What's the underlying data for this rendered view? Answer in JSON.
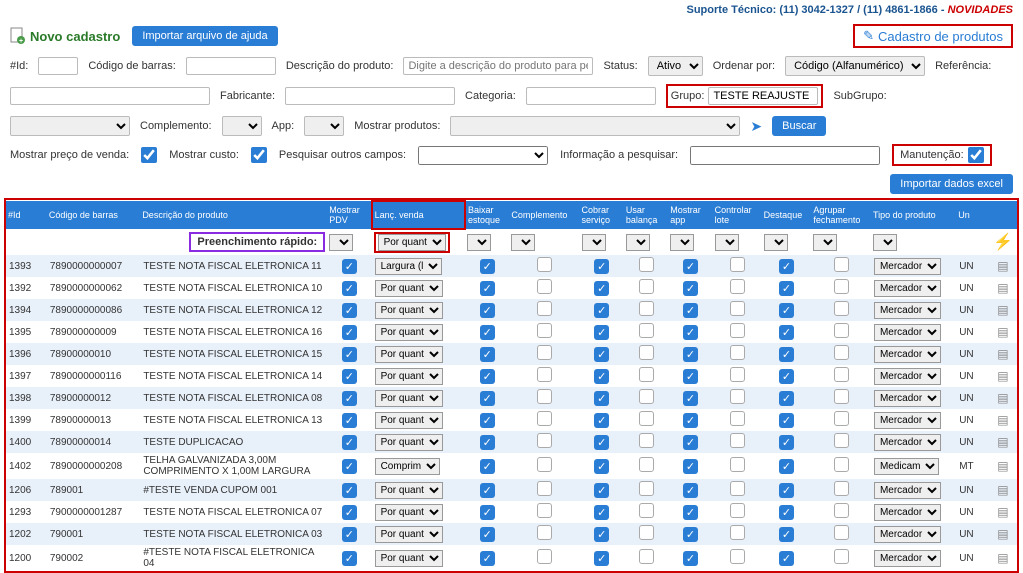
{
  "top": {
    "support_text": "Suporte Técnico: (11) 3042-1327 / (11) 4861-1866 -",
    "novidades": "NOVIDADES"
  },
  "header": {
    "novo_cadastro": "Novo cadastro",
    "importar_ajuda": "Importar arquivo de ajuda",
    "cadastro_produtos": "Cadastro de produtos"
  },
  "filters": {
    "id_label": "#Id:",
    "codigo_barras_label": "Código de barras:",
    "descricao_label": "Descrição do produto:",
    "descricao_placeholder": "Digite a descrição do produto para pesquisa",
    "status_label": "Status:",
    "status_value": "Ativo",
    "ordenar_label": "Ordenar por:",
    "ordenar_value": "Código (Alfanumérico)",
    "referencia_label": "Referência:",
    "fabricante_label": "Fabricante:",
    "categoria_label": "Categoria:",
    "grupo_label": "Grupo:",
    "grupo_value": "TESTE REAJUSTE",
    "subgrupo_label": "SubGrupo:",
    "complemento_label": "Complemento:",
    "app_label": "App:",
    "mostrar_produtos_label": "Mostrar produtos:",
    "buscar": "Buscar",
    "mostrar_preco_label": "Mostrar preço de venda:",
    "mostrar_custo_label": "Mostrar custo:",
    "pesquisar_campos_label": "Pesquisar outros campos:",
    "info_pesquisar_label": "Informação a pesquisar:",
    "manutencao_label": "Manutenção:",
    "importar_excel": "Importar dados excel"
  },
  "table": {
    "headers": [
      "#Id",
      "Código de barras",
      "Descrição do produto",
      "Mostrar PDV",
      "Lanç. venda",
      "Baixar estoque",
      "Complemento",
      "Cobrar serviço",
      "Usar balança",
      "Mostrar app",
      "Controlar lote",
      "Destaque",
      "Agrupar fechamento",
      "Tipo do produto",
      "Un",
      ""
    ],
    "quick_label": "Preenchimento rápido:",
    "rows": [
      {
        "id": "1393",
        "barcode": "7890000000007",
        "desc": "TESTE NOTA FISCAL ELETRONICA 11",
        "lanc": "Largura (l",
        "pdv": true,
        "baixar": true,
        "comp": false,
        "cobrar": true,
        "balanca": false,
        "app": true,
        "lote": false,
        "dest": true,
        "agrupar": false,
        "tipo": "Mercador",
        "un": "UN"
      },
      {
        "id": "1392",
        "barcode": "7890000000062",
        "desc": "TESTE NOTA FISCAL ELETRONICA 10",
        "lanc": "Por quant",
        "pdv": true,
        "baixar": true,
        "comp": false,
        "cobrar": true,
        "balanca": false,
        "app": true,
        "lote": false,
        "dest": true,
        "agrupar": false,
        "tipo": "Mercador",
        "un": "UN"
      },
      {
        "id": "1394",
        "barcode": "7890000000086",
        "desc": "TESTE NOTA FISCAL ELETRONICA 12",
        "lanc": "Por quant",
        "pdv": true,
        "baixar": true,
        "comp": false,
        "cobrar": true,
        "balanca": false,
        "app": true,
        "lote": false,
        "dest": true,
        "agrupar": false,
        "tipo": "Mercador",
        "un": "UN"
      },
      {
        "id": "1395",
        "barcode": "789000000009",
        "desc": "TESTE NOTA FISCAL ELETRONICA 16",
        "lanc": "Por quant",
        "pdv": true,
        "baixar": true,
        "comp": false,
        "cobrar": true,
        "balanca": false,
        "app": true,
        "lote": false,
        "dest": true,
        "agrupar": false,
        "tipo": "Mercador",
        "un": "UN"
      },
      {
        "id": "1396",
        "barcode": "78900000010",
        "desc": "TESTE NOTA FISCAL ELETRONICA 15",
        "lanc": "Por quant",
        "pdv": true,
        "baixar": true,
        "comp": false,
        "cobrar": true,
        "balanca": false,
        "app": true,
        "lote": false,
        "dest": true,
        "agrupar": false,
        "tipo": "Mercador",
        "un": "UN"
      },
      {
        "id": "1397",
        "barcode": "7890000000116",
        "desc": "TESTE NOTA FISCAL ELETRONICA 14",
        "lanc": "Por quant",
        "pdv": true,
        "baixar": true,
        "comp": false,
        "cobrar": true,
        "balanca": false,
        "app": true,
        "lote": false,
        "dest": true,
        "agrupar": false,
        "tipo": "Mercador",
        "un": "UN"
      },
      {
        "id": "1398",
        "barcode": "78900000012",
        "desc": "TESTE NOTA FISCAL ELETRONICA 08",
        "lanc": "Por quant",
        "pdv": true,
        "baixar": true,
        "comp": false,
        "cobrar": true,
        "balanca": false,
        "app": true,
        "lote": false,
        "dest": true,
        "agrupar": false,
        "tipo": "Mercador",
        "un": "UN"
      },
      {
        "id": "1399",
        "barcode": "78900000013",
        "desc": "TESTE NOTA FISCAL ELETRONICA 13",
        "lanc": "Por quant",
        "pdv": true,
        "baixar": true,
        "comp": false,
        "cobrar": true,
        "balanca": false,
        "app": true,
        "lote": false,
        "dest": true,
        "agrupar": false,
        "tipo": "Mercador",
        "un": "UN"
      },
      {
        "id": "1400",
        "barcode": "78900000014",
        "desc": "TESTE DUPLICACAO",
        "lanc": "Por quant",
        "pdv": true,
        "baixar": true,
        "comp": false,
        "cobrar": true,
        "balanca": false,
        "app": true,
        "lote": false,
        "dest": true,
        "agrupar": false,
        "tipo": "Mercador",
        "un": "UN"
      },
      {
        "id": "1402",
        "barcode": "7890000000208",
        "desc": "TELHA GALVANIZADA 3,00M COMPRIMENTO X 1,00M LARGURA",
        "lanc": "Comprim",
        "pdv": true,
        "baixar": true,
        "comp": false,
        "cobrar": true,
        "balanca": false,
        "app": true,
        "lote": false,
        "dest": true,
        "agrupar": false,
        "tipo": "Medicam",
        "un": "MT"
      },
      {
        "id": "1206",
        "barcode": "789001",
        "desc": "#TESTE VENDA CUPOM 001",
        "lanc": "Por quant",
        "pdv": true,
        "baixar": true,
        "comp": false,
        "cobrar": true,
        "balanca": false,
        "app": true,
        "lote": false,
        "dest": true,
        "agrupar": false,
        "tipo": "Mercador",
        "un": "UN"
      },
      {
        "id": "1293",
        "barcode": "7900000001287",
        "desc": "TESTE NOTA FISCAL ELETRONICA 07",
        "lanc": "Por quant",
        "pdv": true,
        "baixar": true,
        "comp": false,
        "cobrar": true,
        "balanca": false,
        "app": true,
        "lote": false,
        "dest": true,
        "agrupar": false,
        "tipo": "Mercador",
        "un": "UN"
      },
      {
        "id": "1202",
        "barcode": "790001",
        "desc": "TESTE NOTA FISCAL ELETRONICA 03",
        "lanc": "Por quant",
        "pdv": true,
        "baixar": true,
        "comp": false,
        "cobrar": true,
        "balanca": false,
        "app": true,
        "lote": false,
        "dest": true,
        "agrupar": false,
        "tipo": "Mercador",
        "un": "UN"
      },
      {
        "id": "1200",
        "barcode": "790002",
        "desc": "#TESTE NOTA FISCAL ELETRONICA 04",
        "lanc": "Por quant",
        "pdv": true,
        "baixar": true,
        "comp": false,
        "cobrar": true,
        "balanca": false,
        "app": true,
        "lote": false,
        "dest": true,
        "agrupar": false,
        "tipo": "Mercador",
        "un": "UN"
      }
    ]
  }
}
